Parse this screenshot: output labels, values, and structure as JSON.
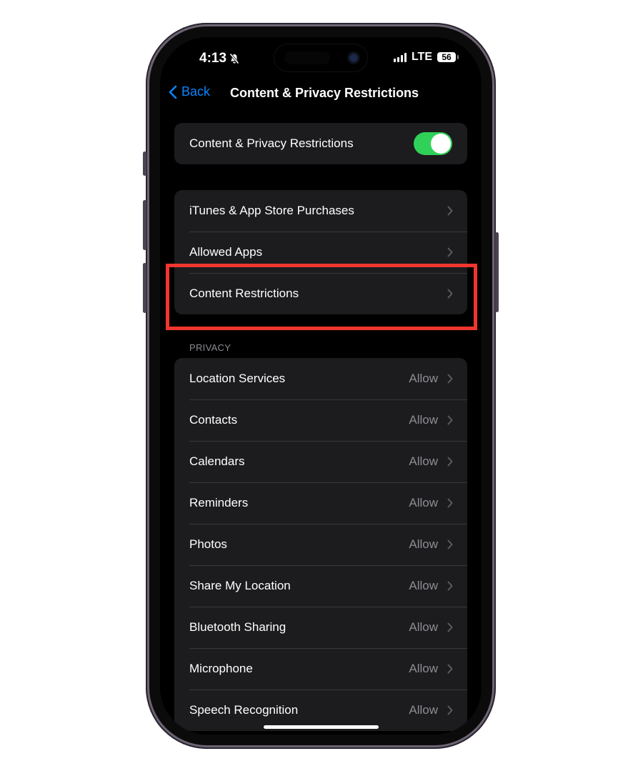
{
  "status_bar": {
    "time": "4:13",
    "network": "LTE",
    "battery": "56"
  },
  "nav": {
    "back_label": "Back",
    "title": "Content & Privacy Restrictions"
  },
  "master_toggle": {
    "label": "Content & Privacy Restrictions",
    "on": true
  },
  "restrictions": [
    {
      "label": "iTunes & App Store Purchases"
    },
    {
      "label": "Allowed Apps"
    },
    {
      "label": "Content Restrictions"
    }
  ],
  "privacy_header": "PRIVACY",
  "privacy_items": [
    {
      "label": "Location Services",
      "value": "Allow"
    },
    {
      "label": "Contacts",
      "value": "Allow"
    },
    {
      "label": "Calendars",
      "value": "Allow"
    },
    {
      "label": "Reminders",
      "value": "Allow"
    },
    {
      "label": "Photos",
      "value": "Allow"
    },
    {
      "label": "Share My Location",
      "value": "Allow"
    },
    {
      "label": "Bluetooth Sharing",
      "value": "Allow"
    },
    {
      "label": "Microphone",
      "value": "Allow"
    },
    {
      "label": "Speech Recognition",
      "value": "Allow"
    }
  ],
  "colors": {
    "accent": "#0a84ff",
    "toggle_on": "#30d158",
    "highlight": "#f0362f"
  }
}
